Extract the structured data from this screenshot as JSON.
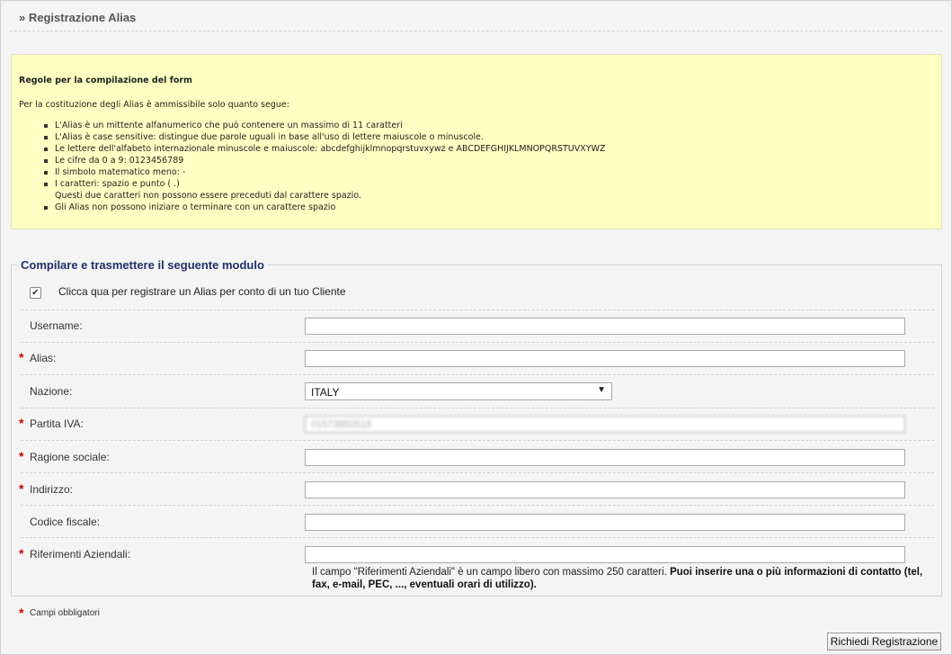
{
  "header": {
    "title": "» Registrazione Alias"
  },
  "rules": {
    "title": "Regole per la compilazione del form",
    "intro": "Per la costituzione degli Alias è ammissibile solo quanto segue:",
    "items": [
      "L'Alias è un mittente alfanumerico che può contenere un massimo di 11 caratteri",
      "L'Alias è case sensitive: distingue due parole uguali in base all'uso di lettere maiuscole o minuscole.",
      "Le lettere dell'alfabeto internazionale minuscole e maiuscole: abcdefghijklmnopqrstuvxywz e ABCDEFGHIJKLMNOPQRSTUVXYWZ",
      "Le cifre da 0 a 9: 0123456789",
      "Il simbolo matematico meno: -",
      "I caratteri: spazio e punto ( .)",
      "Questi due caratteri non possono essere preceduti dal carattere spazio.",
      "Gli Alias non possono iniziare o terminare con un carattere spazio"
    ]
  },
  "form": {
    "legend": "Compilare e trasmettere il seguente modulo",
    "checkbox_label": "Clicca qua per registrare un Alias per conto di un tuo Cliente",
    "checkbox_mark": "✔",
    "required_mark": "*",
    "fields": {
      "username": {
        "label": "Username:",
        "value": ""
      },
      "alias": {
        "label": "Alias:",
        "value": ""
      },
      "nazione": {
        "label": "Nazione:",
        "value": "ITALY"
      },
      "partita_iva": {
        "label": "Partita IVA:",
        "value": "01573850516"
      },
      "ragione_sociale": {
        "label": "Ragione sociale:",
        "value": ""
      },
      "indirizzo": {
        "label": "Indirizzo:",
        "value": ""
      },
      "codice_fiscale": {
        "label": "Codice fiscale:",
        "value": ""
      },
      "riferimenti": {
        "label": "Riferimenti Aziendali:",
        "value": ""
      }
    },
    "help_plain": "Il campo \"Riferimenti Aziendali\" è un campo libero con massimo 250 caratteri.",
    "help_bold": "Puoi inserire una o più informazioni di contatto (tel, fax, e-mail, PEC, ..., eventuali orari di utilizzo).",
    "required_note": "Campi obbligatori",
    "submit_label": "Richiedi Registrazione"
  }
}
